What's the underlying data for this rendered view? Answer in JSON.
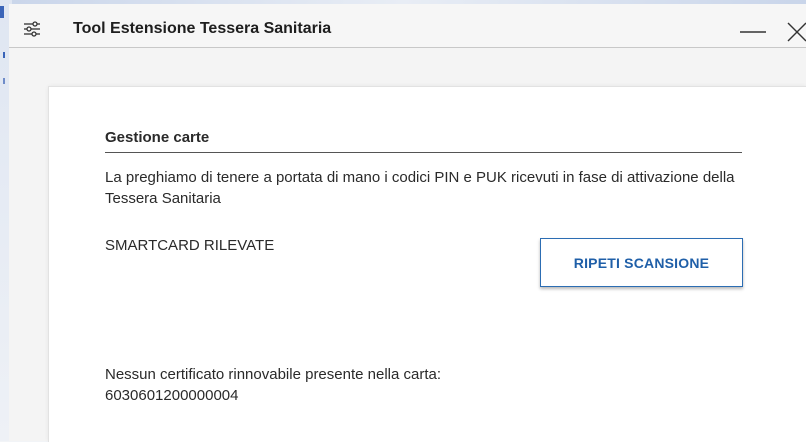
{
  "window": {
    "title": "Tool Estensione Tessera Sanitaria",
    "icon": "sliders-icon",
    "controls": {
      "minimize": "minimize-icon",
      "close": "close-icon"
    }
  },
  "section": {
    "title": "Gestione carte",
    "intro": "La preghiamo di tenere a portata di mano i codici PIN e PUK ricevuti in fase di attivazione della Tessera Sanitaria"
  },
  "smartcards": {
    "label": "SMARTCARD RILEVATE",
    "rescan_button": "RIPETI SCANSIONE"
  },
  "status": {
    "message": "Nessun certificato rinnovabile presente nella carta:",
    "card_number": "6030601200000004"
  },
  "colors": {
    "accent": "#1f5fa8",
    "title_bar": "#f6f6f6",
    "panel": "#ffffff"
  }
}
